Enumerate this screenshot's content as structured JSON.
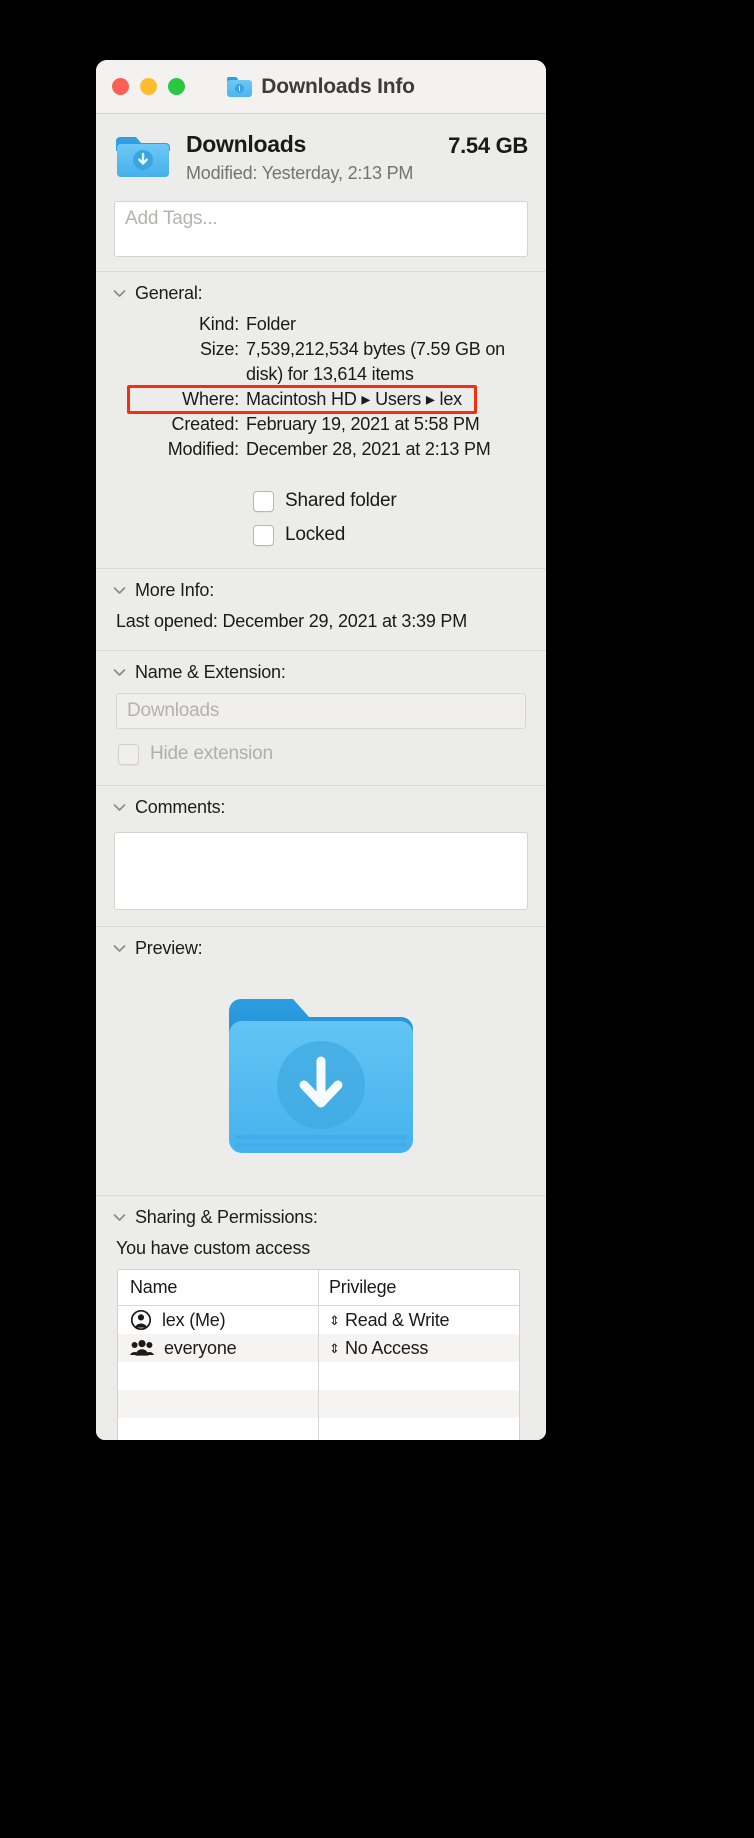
{
  "window": {
    "title": "Downloads Info",
    "title_icon": "folder-downloads-icon",
    "traffic_lights": {
      "close": "close-button",
      "minimize": "minimize-button",
      "zoom": "zoom-button"
    }
  },
  "header": {
    "name": "Downloads",
    "size": "7.54 GB",
    "modified_label": "Modified:",
    "modified_value": "Yesterday, 2:13 PM",
    "modified_line": "Modified: Yesterday, 2:13 PM"
  },
  "tags": {
    "placeholder": "Add Tags..."
  },
  "general": {
    "title": "General:",
    "kind": {
      "label": "Kind:",
      "value": "Folder"
    },
    "size": {
      "label": "Size:",
      "line1": "7,539,212,534 bytes (7.59 GB on",
      "line2": "disk) for 13,614 items"
    },
    "where": {
      "label": "Where:",
      "value": "Macintosh HD ▸ Users ▸ lex",
      "parts": [
        "Macintosh HD",
        "Users",
        "lex"
      ],
      "highlighted": true,
      "highlight_color": "#f22f14"
    },
    "created": {
      "label": "Created:",
      "value": "February 19, 2021 at 5:58 PM"
    },
    "modified": {
      "label": "Modified:",
      "value": "December 28, 2021 at 2:13 PM"
    },
    "checkboxes": [
      {
        "label": "Shared folder",
        "checked": false,
        "enabled": true
      },
      {
        "label": "Locked",
        "checked": false,
        "enabled": true
      }
    ]
  },
  "more_info": {
    "title": "More Info:",
    "last_opened_label": "Last opened:",
    "last_opened_value": "December 29, 2021 at 3:39 PM",
    "last_opened_line": "Last opened: December 29, 2021 at 3:39 PM"
  },
  "name_extension": {
    "title": "Name & Extension:",
    "value": "Downloads",
    "hide_extension": {
      "label": "Hide extension",
      "checked": false,
      "enabled": false
    }
  },
  "comments": {
    "title": "Comments:",
    "value": ""
  },
  "preview": {
    "title": "Preview:",
    "icon": "folder-downloads-large-icon"
  },
  "sharing": {
    "title": "Sharing & Permissions:",
    "access_note": "You have custom access",
    "columns": [
      "Name",
      "Privilege"
    ],
    "rows": [
      {
        "icon": "user-icon",
        "name": "lex (Me)",
        "privilege": "Read & Write"
      },
      {
        "icon": "group-icon",
        "name": "everyone",
        "privilege": "No Access"
      }
    ],
    "empty_row_count": 3
  }
}
